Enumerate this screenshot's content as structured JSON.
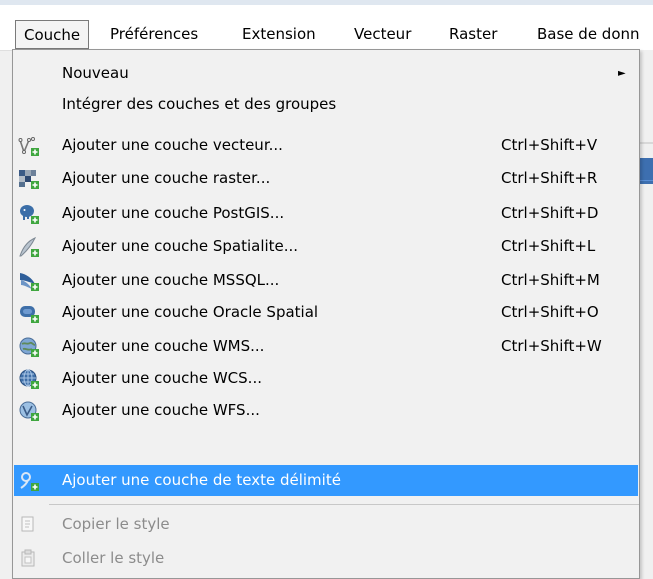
{
  "menubar": {
    "items": [
      "Couche",
      "Préférences",
      "Extension",
      "Vecteur",
      "Raster",
      "Base de donn"
    ]
  },
  "menu": {
    "items": [
      {
        "label": "Nouveau",
        "shortcut": "",
        "icon": "",
        "has_submenu": true
      },
      {
        "label": "Intégrer des couches et des groupes",
        "shortcut": "",
        "icon": ""
      },
      {
        "label": "Ajouter une couche vecteur...",
        "shortcut": "Ctrl+Shift+V",
        "icon": "vector-layer-icon"
      },
      {
        "label": "Ajouter une couche raster...",
        "shortcut": "Ctrl+Shift+R",
        "icon": "raster-layer-icon"
      },
      {
        "label": "Ajouter une couche PostGIS...",
        "shortcut": "Ctrl+Shift+D",
        "icon": "postgis-icon"
      },
      {
        "label": "Ajouter une couche Spatialite...",
        "shortcut": "Ctrl+Shift+L",
        "icon": "spatialite-icon"
      },
      {
        "label": "Ajouter une couche MSSQL...",
        "shortcut": "Ctrl+Shift+M",
        "icon": "mssql-icon"
      },
      {
        "label": "Ajouter une couche Oracle Spatial",
        "shortcut": "Ctrl+Shift+O",
        "icon": "oracle-icon"
      },
      {
        "label": "Ajouter une couche WMS...",
        "shortcut": "Ctrl+Shift+W",
        "icon": "wms-globe-icon"
      },
      {
        "label": "Ajouter une couche WCS...",
        "shortcut": "",
        "icon": "wcs-globe-icon"
      },
      {
        "label": "Ajouter une couche WFS...",
        "shortcut": "",
        "icon": "wfs-globe-icon"
      },
      {
        "label": "Ajouter une couche de texte délimité",
        "shortcut": "",
        "icon": "delimited-text-icon",
        "highlighted": true
      },
      {
        "label": "Copier le style",
        "shortcut": "",
        "icon": "copy-style-icon",
        "disabled": true
      },
      {
        "label": "Coller le style",
        "shortcut": "",
        "icon": "paste-style-icon",
        "disabled": true
      }
    ]
  },
  "colors": {
    "highlight": "#3399ff",
    "disabled_text": "#8c8c8c",
    "menu_bg": "#f1f1f1"
  }
}
